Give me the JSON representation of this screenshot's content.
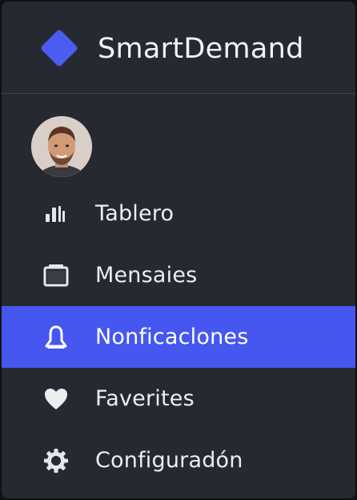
{
  "app": {
    "name": "SmartDemand",
    "logo_icon": "diamond-logo-icon",
    "accent_color": "#4657ef"
  },
  "user": {
    "avatar_icon": "user-avatar"
  },
  "nav": {
    "items": [
      {
        "label": "Tablero",
        "icon": "bar-chart-icon",
        "active": false
      },
      {
        "label": "Mensaies",
        "icon": "inbox-icon",
        "active": false
      },
      {
        "label": "Nonficaclones",
        "icon": "bell-icon",
        "active": true
      },
      {
        "label": "Faverites",
        "icon": "heart-icon",
        "active": false
      },
      {
        "label": "Configuradón",
        "icon": "gear-icon",
        "active": false
      }
    ]
  }
}
